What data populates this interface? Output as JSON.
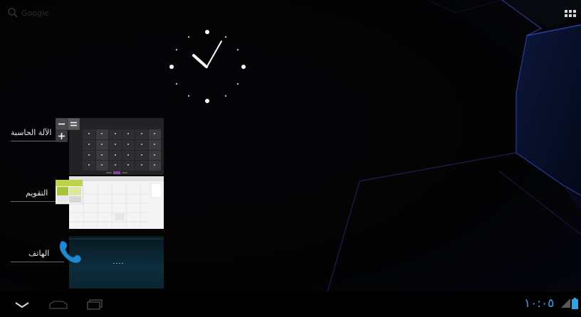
{
  "search": {
    "label": "Google"
  },
  "recent_apps": [
    {
      "id": "calculator",
      "label": "الآلة الحاسبة",
      "icon": "calculator-icon"
    },
    {
      "id": "calendar",
      "label": "التقويم",
      "icon": "calendar-icon"
    },
    {
      "id": "phone",
      "label": "الهاتف",
      "icon": "phone-icon"
    }
  ],
  "status_bar": {
    "time": "١٠:٠٥",
    "accent_color": "#2aa5e6",
    "icons": [
      "signal-icon",
      "battery-icon"
    ]
  },
  "nav": {
    "buttons": [
      "back-button",
      "home-button",
      "recent-apps-button"
    ]
  },
  "home": {
    "icons": [
      "search-icon",
      "apps-grid-icon",
      "analog-clock-widget"
    ]
  },
  "colors": {
    "background": "#000000",
    "accent": "#2aa5e6",
    "phone_icon": "#1e8ad2"
  }
}
